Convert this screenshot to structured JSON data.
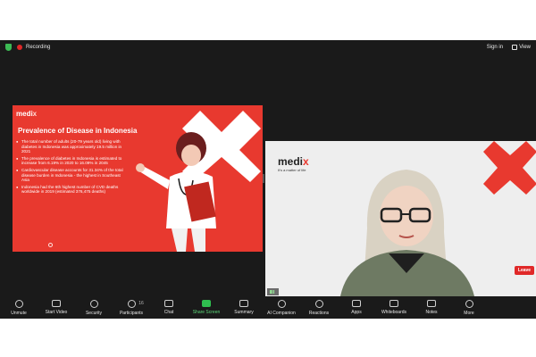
{
  "topbar": {
    "recording_label": "Recording",
    "signin_label": "Sign in",
    "view_label": "View"
  },
  "slide": {
    "logo": "medi",
    "logo_x": "x",
    "title": "Prevalence of Disease in Indonesia",
    "bullets": [
      "The total number of adults (20-79 years old) living with diabetes in Indonesia was approximately 19.5 million in 2021",
      "The prevalence of diabetes in Indonesia is estimated to increase from 6.19% in 2020 to 16.09% in 2045",
      "Cardiovascular disease accounts for 31.34% of the total disease burden in Indonesia - the highest in Southeast Asia",
      "Indonesia had the 6th highest number of CVD deaths worldwide in 2019 (estimated 376,475 deaths)"
    ]
  },
  "camera": {
    "brand": "medi",
    "brand_x": "x",
    "tagline": "It's a matter of life"
  },
  "toolbar": {
    "items": [
      {
        "label": "Unmute",
        "icon": "microphone-muted-icon"
      },
      {
        "label": "Start Video",
        "icon": "video-off-icon"
      },
      {
        "label": "Security",
        "icon": "shield-icon"
      },
      {
        "label": "Participants",
        "count": "16",
        "icon": "participants-icon"
      },
      {
        "label": "Chat",
        "icon": "chat-icon"
      },
      {
        "label": "Share Screen",
        "icon": "share-screen-icon"
      },
      {
        "label": "Summary",
        "icon": "summary-icon"
      },
      {
        "label": "AI Companion",
        "icon": "ai-companion-icon"
      },
      {
        "label": "Reactions",
        "icon": "reactions-icon"
      },
      {
        "label": "Apps",
        "icon": "apps-icon"
      },
      {
        "label": "Whiteboards",
        "icon": "whiteboard-icon"
      },
      {
        "label": "Notes",
        "icon": "notes-icon"
      },
      {
        "label": "More",
        "icon": "more-icon"
      }
    ],
    "leave_label": "Leave"
  },
  "colors": {
    "brand_red": "#e8392f",
    "share_green": "#2fbf4f",
    "leave_red": "#e02828",
    "recording_red": "#e02828"
  }
}
